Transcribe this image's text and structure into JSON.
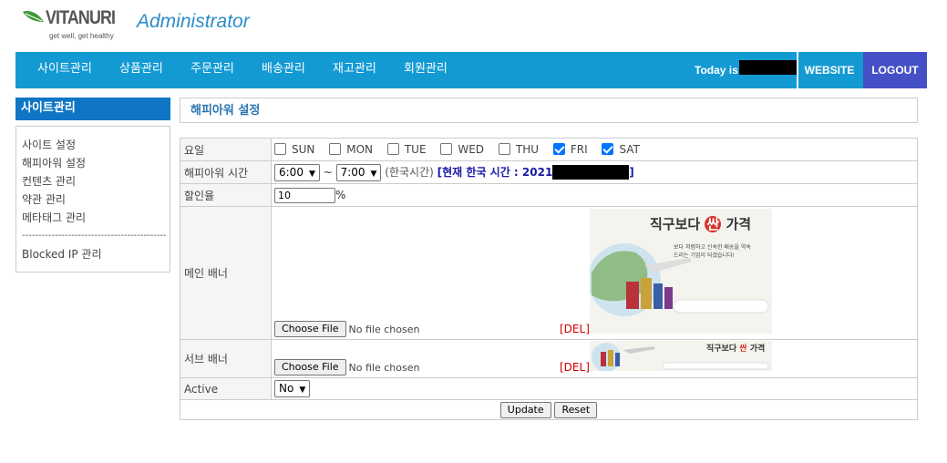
{
  "header": {
    "brand": "VITANURI",
    "tagline": "get well, get healthy",
    "title": "Administrator",
    "today_label": "Today is",
    "website_label": "WEBSITE",
    "logout_label": "LOGOUT"
  },
  "nav": [
    "사이트관리",
    "상품관리",
    "주문관리",
    "배송관리",
    "재고관리",
    "회원관리"
  ],
  "sidebar": {
    "heading": "사이트관리",
    "links": [
      "사이트 설정",
      "해피아워 설정",
      "컨텐츠 관리",
      "약관 관리",
      "메타태그 관리"
    ],
    "separator": "----------------------------------------------",
    "blocked_ip": "Blocked IP 관리"
  },
  "page_title": "해피아워 설정",
  "form": {
    "day_label": "요일",
    "days": [
      {
        "label": "SUN",
        "checked": false
      },
      {
        "label": "MON",
        "checked": false
      },
      {
        "label": "TUE",
        "checked": false
      },
      {
        "label": "WED",
        "checked": false
      },
      {
        "label": "THU",
        "checked": false
      },
      {
        "label": "FRI",
        "checked": true
      },
      {
        "label": "SAT",
        "checked": true
      }
    ],
    "time_label": "해피아워 시간",
    "time_start": "6:00",
    "time_sep": "~",
    "time_end": "7:00",
    "timezone_note": "(한국시간)",
    "korea_time_prefix": "[현재 한국 시간 : 2021",
    "korea_time_suffix": "]",
    "discount_label": "할인율",
    "discount_value": "10",
    "discount_unit": "%",
    "main_banner_label": "메인 배너",
    "sub_banner_label": "서브 배너",
    "choose_file": "Choose File",
    "no_file": "No file chosen",
    "del_label": "[DEL]",
    "active_label": "Active",
    "active_value": "No",
    "update_label": "Update",
    "reset_label": "Reset",
    "banner_text": {
      "headline_a": "직구보다",
      "headline_b": "싼",
      "headline_c": "가격",
      "sub_line1": "보다 저렴하고 신속한 배송을 약속",
      "sub_line2": "드리는 기업이 되겠습니다!"
    }
  },
  "colors": {
    "nav_bg": "#139ad3",
    "logout_bg": "#4650c6",
    "sidebar_head_bg": "#0f76c5",
    "title_blue": "#2b8dc8",
    "del_red": "#d00000",
    "checkbox_blue": "#0075ff"
  }
}
